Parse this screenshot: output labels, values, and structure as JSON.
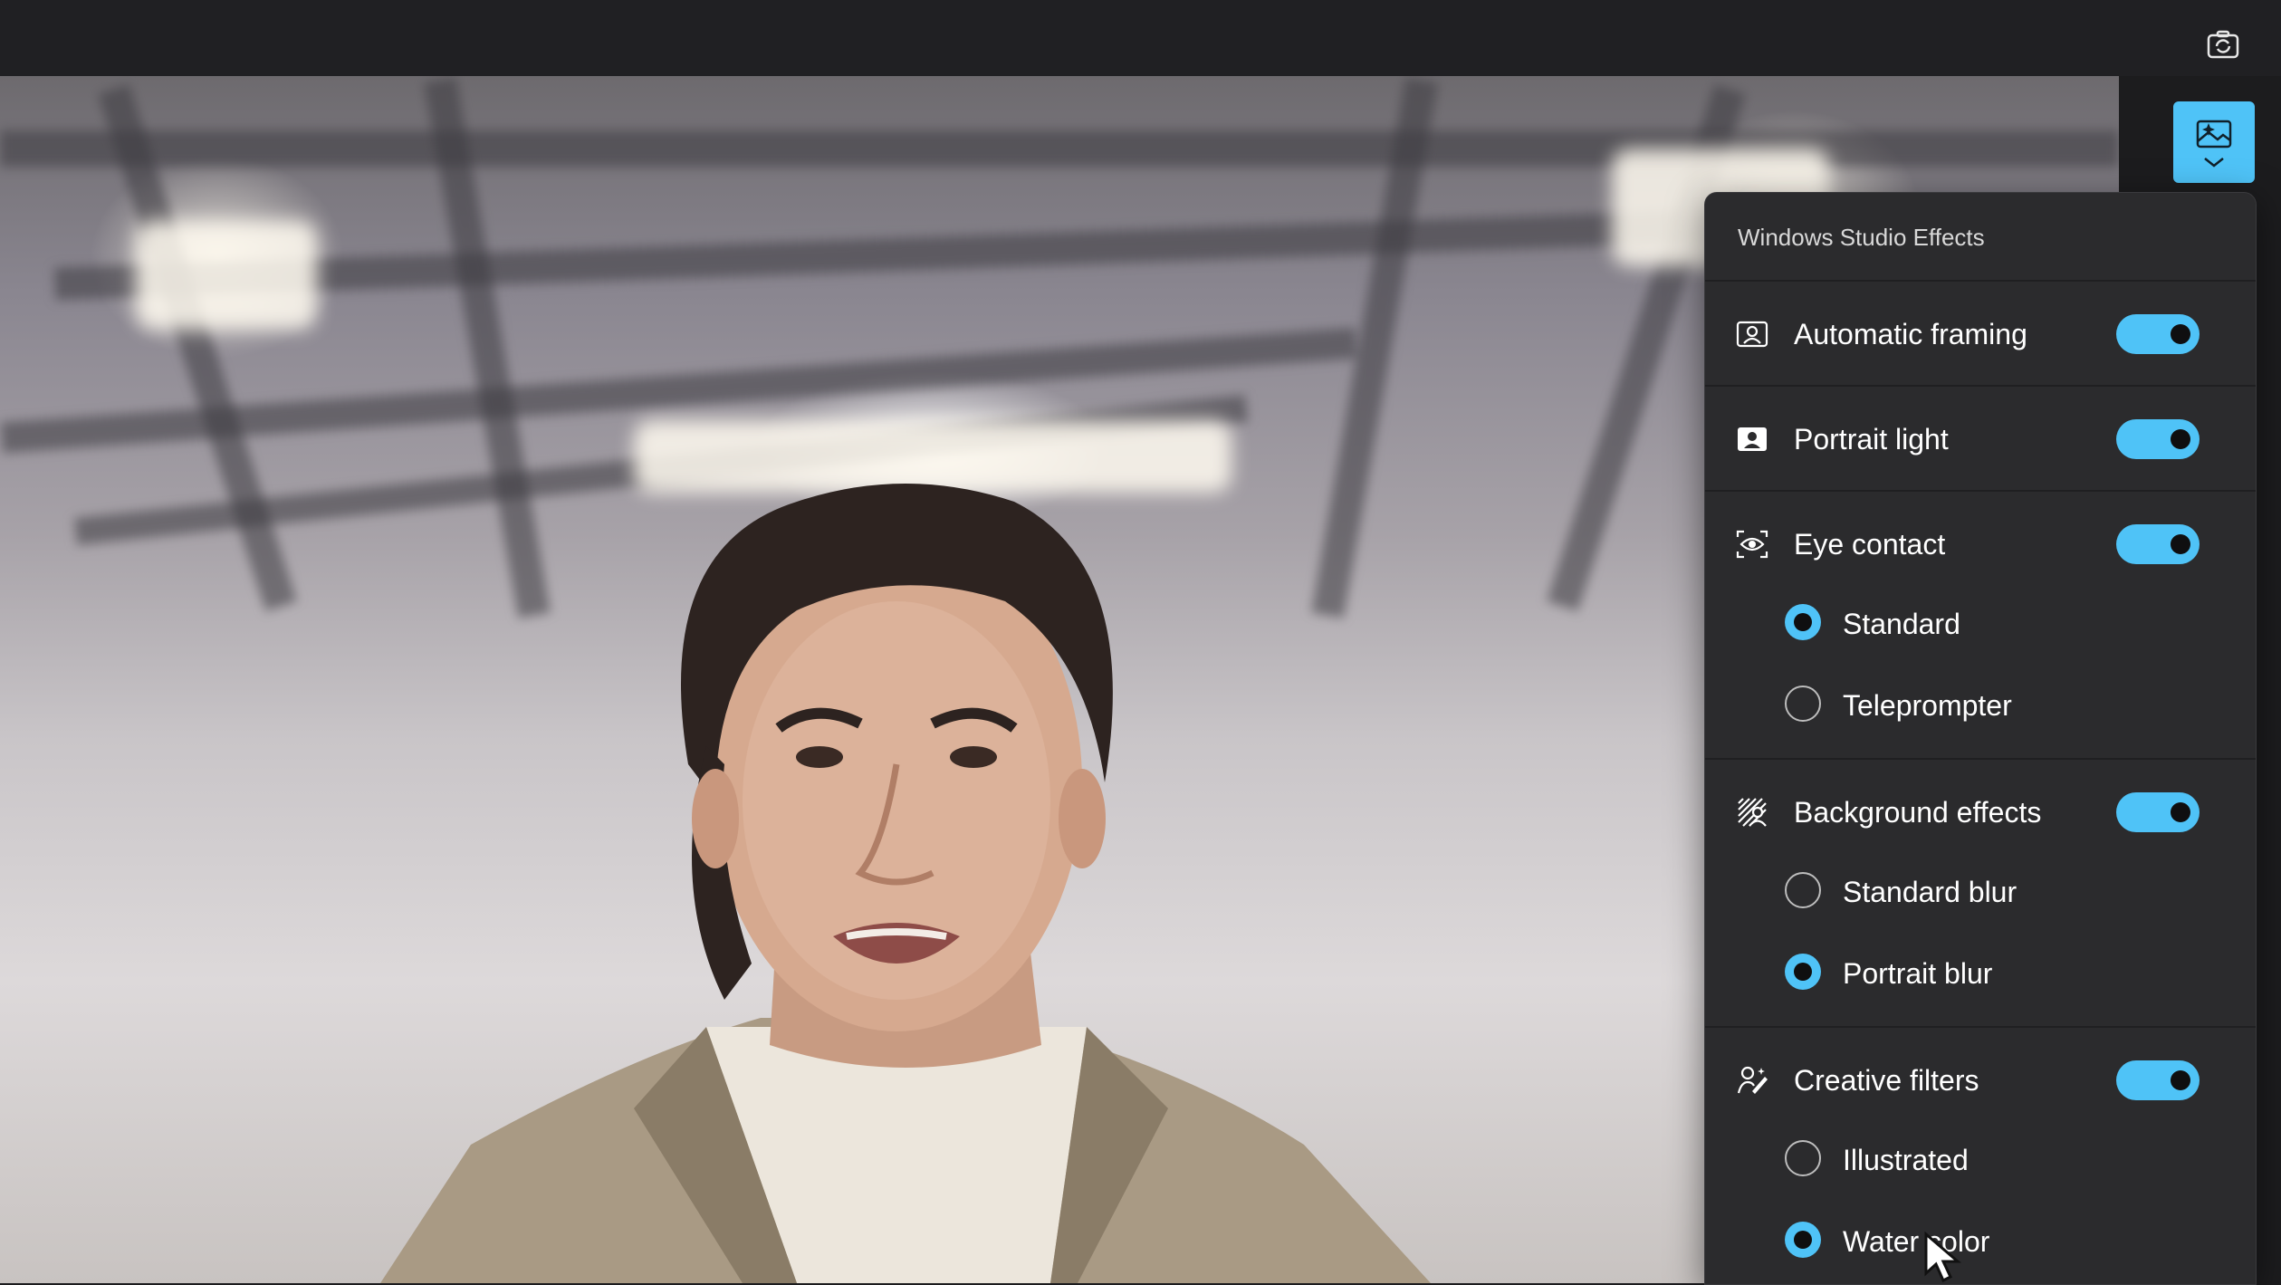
{
  "panel": {
    "title": "Windows Studio Effects",
    "effects": [
      {
        "label": "Automatic framing",
        "icon": "framing-icon",
        "enabled": true
      },
      {
        "label": "Portrait light",
        "icon": "portrait-light-icon",
        "enabled": true
      },
      {
        "label": "Eye contact",
        "icon": "eye-contact-icon",
        "enabled": true,
        "options": [
          {
            "label": "Standard",
            "selected": true
          },
          {
            "label": "Teleprompter",
            "selected": false
          }
        ]
      },
      {
        "label": "Background effects",
        "icon": "background-effects-icon",
        "enabled": true,
        "options": [
          {
            "label": "Standard blur",
            "selected": false
          },
          {
            "label": "Portrait blur",
            "selected": true
          }
        ]
      },
      {
        "label": "Creative filters",
        "icon": "creative-filters-icon",
        "enabled": true,
        "options": [
          {
            "label": "Illustrated",
            "selected": false
          },
          {
            "label": "Water color",
            "selected": true
          }
        ]
      }
    ]
  },
  "toolbar": {
    "camera_switch_icon": "camera-switch-icon",
    "effects_button_icon": "studio-effects-icon"
  },
  "colors": {
    "accent": "#4fc3f7",
    "panel_bg": "#2b2b2d",
    "topbar_bg": "#202023"
  }
}
